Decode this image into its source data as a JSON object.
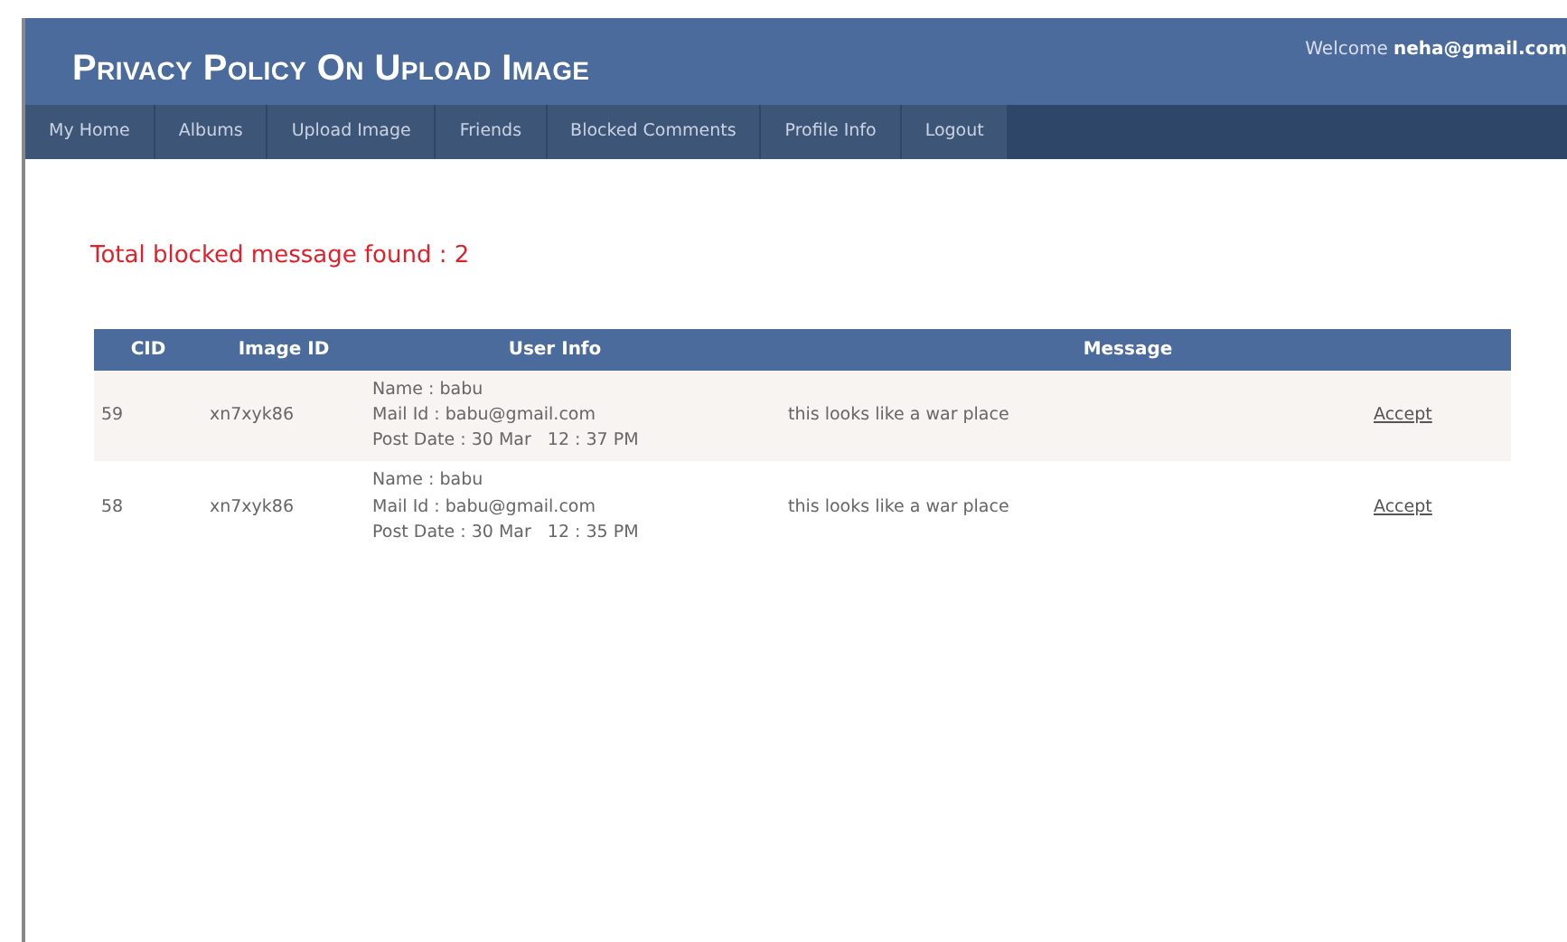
{
  "header": {
    "title": "Privacy Policy On Upload Image",
    "welcome": "Welcome",
    "user": "neha@gmail.com"
  },
  "nav": [
    "My Home",
    "Albums",
    "Upload Image",
    "Friends",
    "Blocked Comments",
    "Profile Info",
    "Logout"
  ],
  "summary": "Total blocked message found : 2",
  "table": {
    "columns": [
      "CID",
      "Image ID",
      "User Info",
      "Message"
    ],
    "rows": [
      {
        "cid": "59",
        "image_id": "xn7xyk86",
        "user_info": [
          "Name : babu",
          "Mail Id : babu@gmail.com",
          "Post Date : 30 Mar   12 : 37 PM"
        ],
        "message": "this looks like a war place",
        "action": "Accept"
      },
      {
        "cid": "58",
        "image_id": "xn7xyk86",
        "user_info": [
          "Name : babu",
          "Mail Id : babu@gmail.com",
          "Post Date : 30 Mar   12 : 35 PM"
        ],
        "message": "this looks like a war place",
        "action": "Accept"
      }
    ]
  }
}
